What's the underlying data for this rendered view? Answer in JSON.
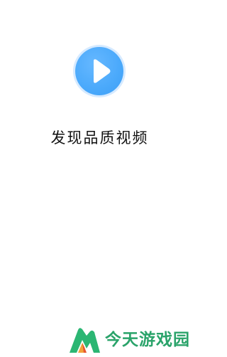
{
  "splash": {
    "tagline": "发现品质视频"
  },
  "watermark": {
    "text": "今天游戏园"
  },
  "colors": {
    "logo_blue": "#4aa9fb",
    "watermark_green": "#2aa36a"
  },
  "icons": {
    "app_logo": "play-icon",
    "watermark_logo": "mountain-logo-icon"
  }
}
